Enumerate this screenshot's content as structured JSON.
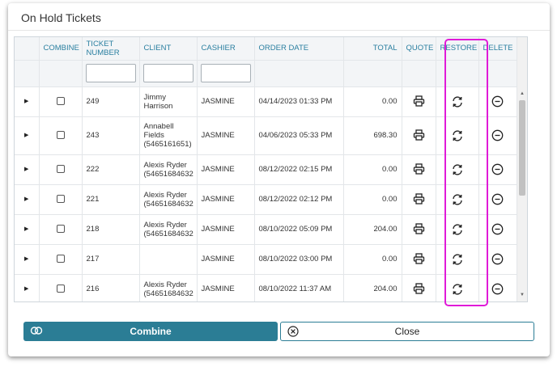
{
  "dialog": {
    "title": "On Hold Tickets"
  },
  "table": {
    "columns": {
      "combine": "COMBINE",
      "ticket_number": "TICKET NUMBER",
      "client": "CLIENT",
      "cashier": "CASHIER",
      "order_date": "ORDER DATE",
      "total": "TOTAL",
      "quote": "QUOTE",
      "restore": "RESTORE",
      "delete": "DELETE"
    },
    "rows": [
      {
        "ticket": "249",
        "client_line1": "Jimmy",
        "client_line2": "Harrison",
        "client_line3": "",
        "cashier": "JASMINE",
        "date": "04/14/2023 01:33 PM",
        "total": "0.00"
      },
      {
        "ticket": "243",
        "client_line1": "Annabell",
        "client_line2": "Fields",
        "client_line3": "(5465161651)",
        "cashier": "JASMINE",
        "date": "04/06/2023 05:33 PM",
        "total": "698.30"
      },
      {
        "ticket": "222",
        "client_line1": "Alexis Ryder",
        "client_line2": "(54651684632",
        "client_line3": "",
        "cashier": "JASMINE",
        "date": "08/12/2022 02:15 PM",
        "total": "0.00"
      },
      {
        "ticket": "221",
        "client_line1": "Alexis Ryder",
        "client_line2": "(54651684632",
        "client_line3": "",
        "cashier": "JASMINE",
        "date": "08/12/2022 02:12 PM",
        "total": "0.00"
      },
      {
        "ticket": "218",
        "client_line1": "Alexis Ryder",
        "client_line2": "(54651684632",
        "client_line3": "",
        "cashier": "JASMINE",
        "date": "08/10/2022 05:09 PM",
        "total": "204.00"
      },
      {
        "ticket": "217",
        "client_line1": "",
        "client_line2": "",
        "client_line3": "",
        "cashier": "JASMINE",
        "date": "08/10/2022 03:00 PM",
        "total": "0.00"
      },
      {
        "ticket": "216",
        "client_line1": "Alexis Ryder",
        "client_line2": "(54651684632",
        "client_line3": "",
        "cashier": "JASMINE",
        "date": "08/10/2022 11:37 AM",
        "total": "204.00"
      }
    ]
  },
  "buttons": {
    "combine": "Combine",
    "close": "Close"
  },
  "colors": {
    "accent": "#2b7d95",
    "header_text": "#2a7fa0",
    "highlight": "#e01ad8"
  },
  "icons": {
    "expand": "triangle-right-icon",
    "quote": "printer-icon",
    "restore": "refresh-icon",
    "delete": "minus-circle-icon",
    "combine": "link-rings-icon",
    "close": "close-circle-icon"
  }
}
